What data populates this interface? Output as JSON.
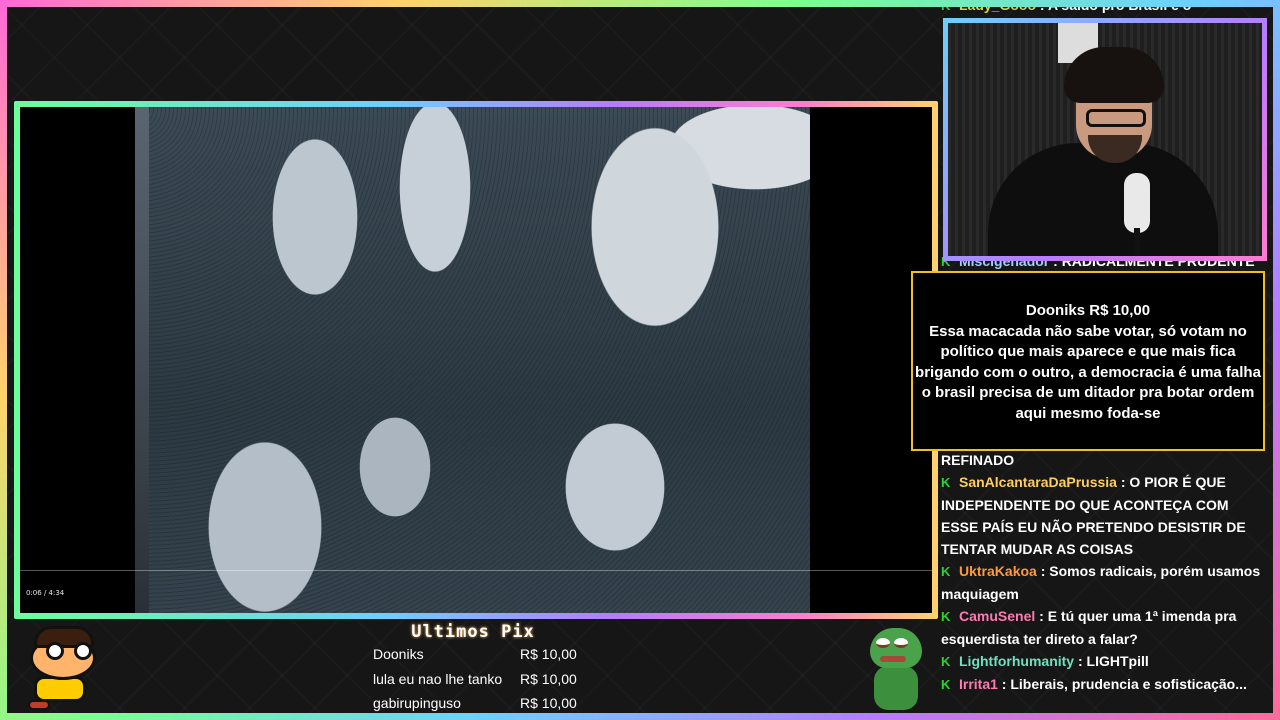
{
  "video": {
    "time_label": "0:06 / 4:34"
  },
  "chat": {
    "top_message": {
      "user": "Lady_Gooo",
      "user_color": "#d8d250",
      "text": " : A saido pro Brasil é o"
    },
    "partial_message": {
      "user": "Miscigenador",
      "user_color": "#9fd0ff",
      "text": " : RADICALMENTE PRUDENTE E"
    },
    "continuation": "REFINADO",
    "messages": [
      {
        "user": "SanAlcantaraDaPrussia",
        "user_color": "#ffcf5c",
        "text": " : O PIOR É QUE INDEPENDENTE DO QUE ACONTEÇA COM ESSE PAÍS EU NÃO PRETENDO DESISTIR DE TENTAR MUDAR AS COISAS"
      },
      {
        "user": "UktraKakoa",
        "user_color": "#ff9a3c",
        "text": " : Somos radicais, porém usamos maquiagem"
      },
      {
        "user": "CamuSenel",
        "user_color": "#ff7ab0",
        "text": " : E tú quer uma 1ª imenda pra esquerdista ter direto a falar?"
      },
      {
        "user": "Lightforhumanity",
        "user_color": "#6fe0c0",
        "text": " : LIGHTpill"
      },
      {
        "user": "Irrita1",
        "user_color": "#ff7ab0",
        "text": " : Liberais, prudencia e sofisticação..."
      }
    ],
    "badge_icon": "moderator-badge-icon",
    "badge_color": "#2fd12f"
  },
  "donation": {
    "title": "Dooniks R$ 10,00",
    "message": "Essa macacada não sabe votar, só votam no político que mais aparece e que mais fica brigando com o outro, a democracia é uma falha o brasil precisa de um ditador pra botar ordem aqui mesmo foda-se",
    "border_color": "#f0c020"
  },
  "pix_panel": {
    "title": "Ultimos Pix",
    "rows": [
      {
        "name": "Dooniks",
        "amount": "R$ 10,00"
      },
      {
        "name": "lula eu nao lhe tanko",
        "amount": "R$ 10,00"
      },
      {
        "name": "gabirupinguso",
        "amount": "R$ 10,00"
      }
    ]
  }
}
